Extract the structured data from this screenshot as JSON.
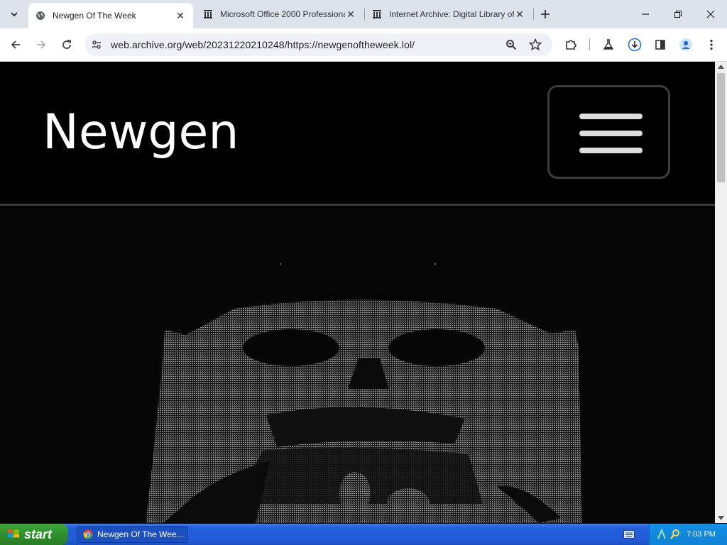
{
  "browser": {
    "tabs": [
      {
        "title": "Newgen Of The Week",
        "active": true
      },
      {
        "title": "Microsoft Office 2000 Professional",
        "active": false
      },
      {
        "title": "Internet Archive: Digital Library of",
        "active": false
      }
    ],
    "url": "web.archive.org/web/20231220210248/https://newgenoftheweek.lol/"
  },
  "site": {
    "brand": "Newgen"
  },
  "taskbar": {
    "start_label": "start",
    "task_label": "Newgen Of The Wee...",
    "clock": "7:03 PM"
  },
  "colors": {
    "page_bg": "#000000",
    "tab_strip": "#dee3eb",
    "xp_taskbar": "#245edb",
    "xp_start": "#3fa73a"
  }
}
